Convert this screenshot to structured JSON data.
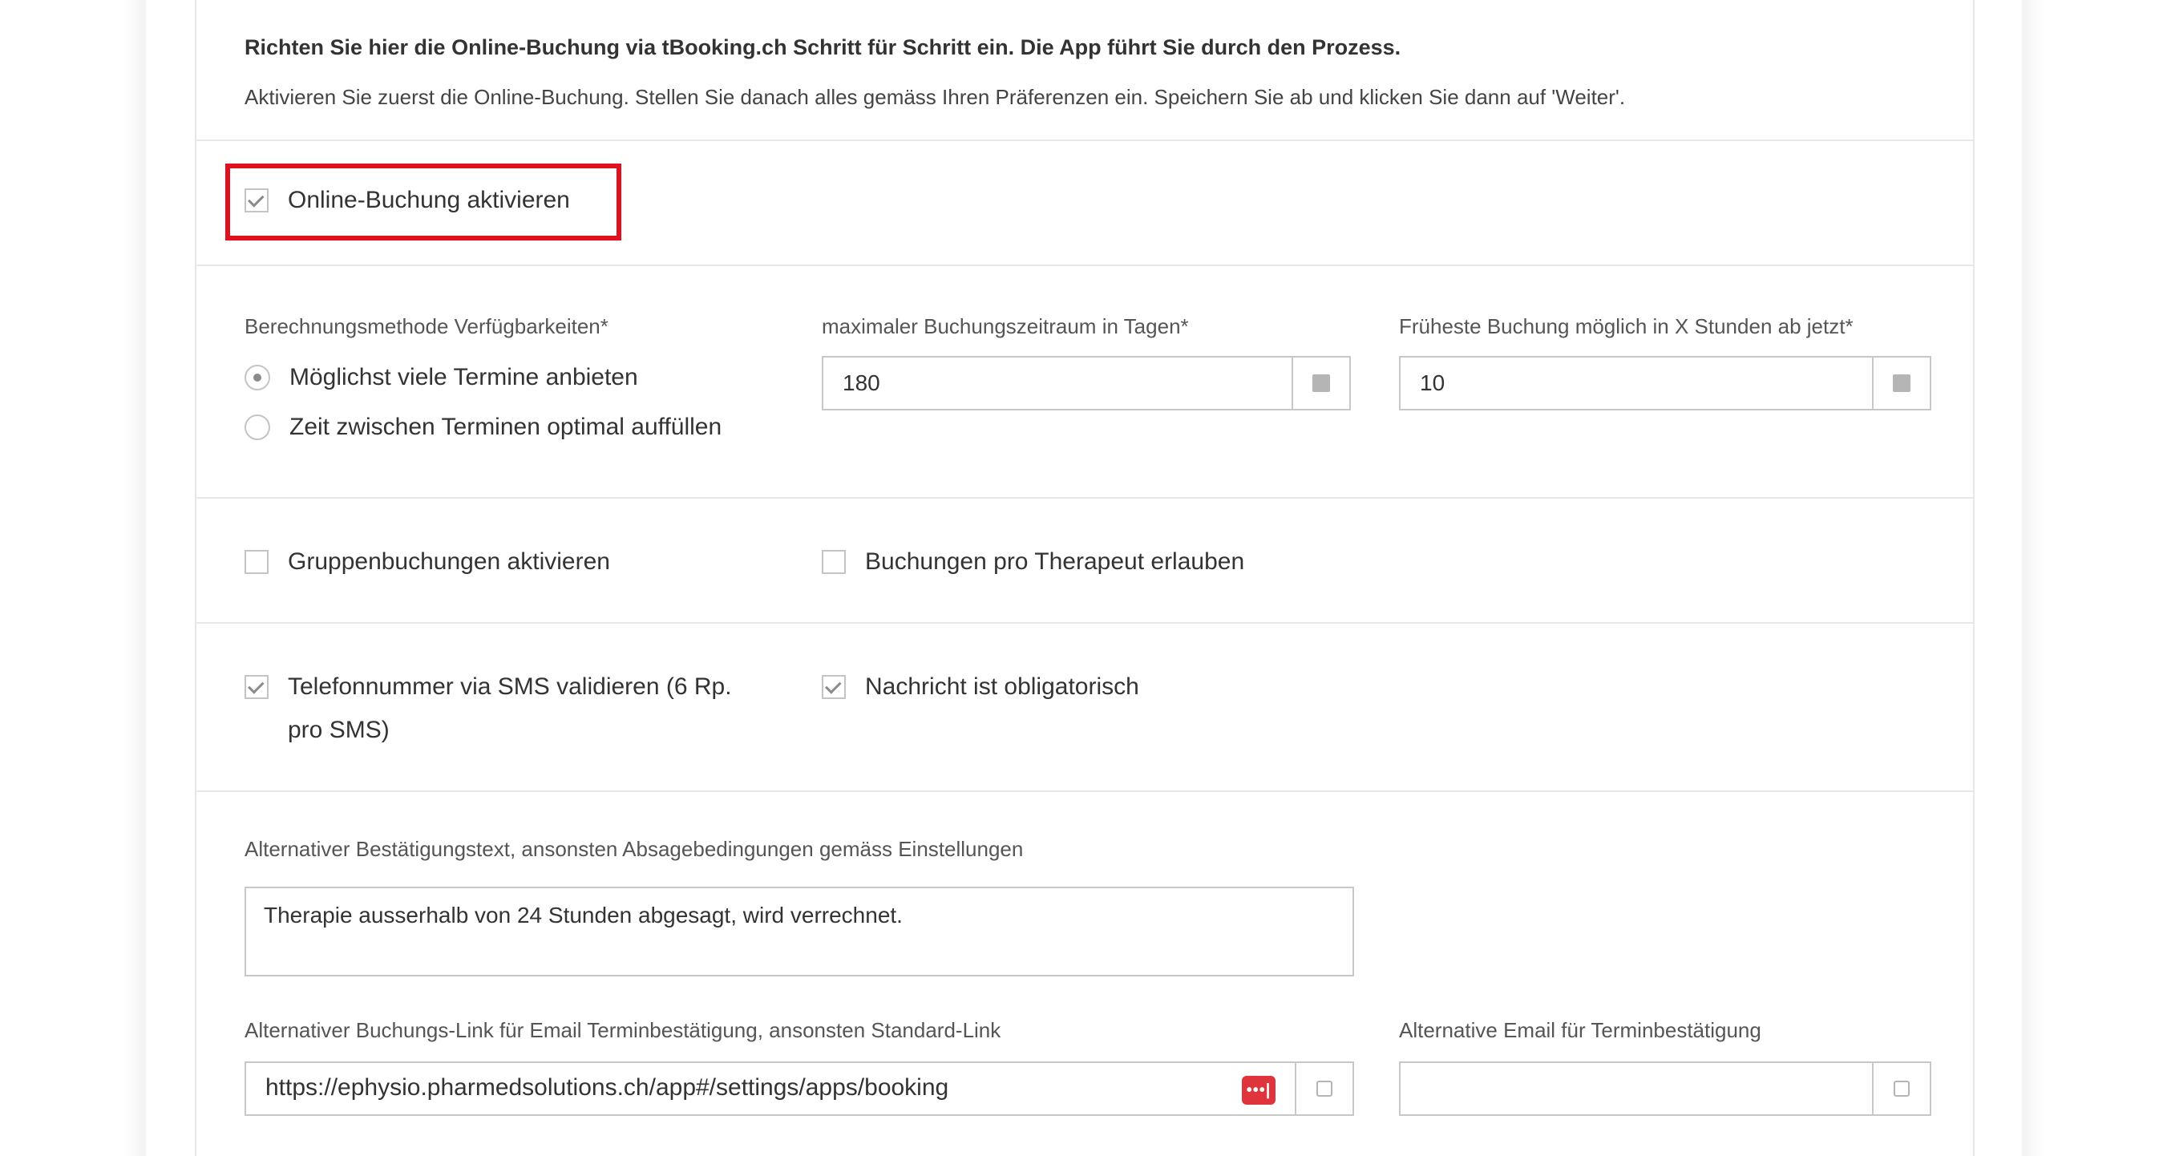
{
  "intro": {
    "headline": "Richten Sie hier die Online-Buchung via tBooking.ch Schritt für Schritt ein. Die App führt Sie durch den Prozess.",
    "text": "Aktivieren Sie zuerst die Online-Buchung. Stellen Sie danach alles gemäss Ihren Präferenzen ein. Speichern Sie ab und klicken Sie dann auf 'Weiter'."
  },
  "activate": {
    "label": "Online-Buchung aktivieren",
    "checked": true,
    "highlight_color": "#e0101e"
  },
  "calc_method": {
    "label": "Berechnungsmethode Verfügbarkeiten*",
    "options": [
      {
        "label": "Möglichst viele Termine anbieten",
        "selected": true
      },
      {
        "label": "Zeit zwischen Terminen optimal auffüllen",
        "selected": false
      }
    ]
  },
  "max_period": {
    "label": "maximaler Buchungszeitraum in Tagen*",
    "value": "180"
  },
  "earliest_booking": {
    "label": "Früheste Buchung möglich in X Stunden ab jetzt*",
    "value": "10"
  },
  "group_booking": {
    "label": "Gruppenbuchungen aktivieren",
    "checked": false
  },
  "per_therapist": {
    "label": "Buchungen pro Therapeut erlauben",
    "checked": false
  },
  "sms_validate": {
    "label_line1": "Telefonnummer via SMS validieren (6 Rp.",
    "label_line2": "pro SMS)",
    "checked": true
  },
  "message_required": {
    "label": "Nachricht ist obligatorisch",
    "checked": true
  },
  "alt_confirmation": {
    "label": "Alternativer Bestätigungstext, ansonsten Absagebedingungen gemäss Einstellungen",
    "value": "Therapie ausserhalb von 24 Stunden abgesagt, wird verrechnet."
  },
  "alt_link": {
    "label": "Alternativer Buchungs-Link für Email Terminbestätigung, ansonsten Standard-Link",
    "value": "https://ephysio.pharmedsolutions.ch/app#/settings/apps/booking",
    "pw_icon_text": "•••|"
  },
  "alt_email": {
    "label": "Alternative Email für Terminbestätigung",
    "value": ""
  }
}
